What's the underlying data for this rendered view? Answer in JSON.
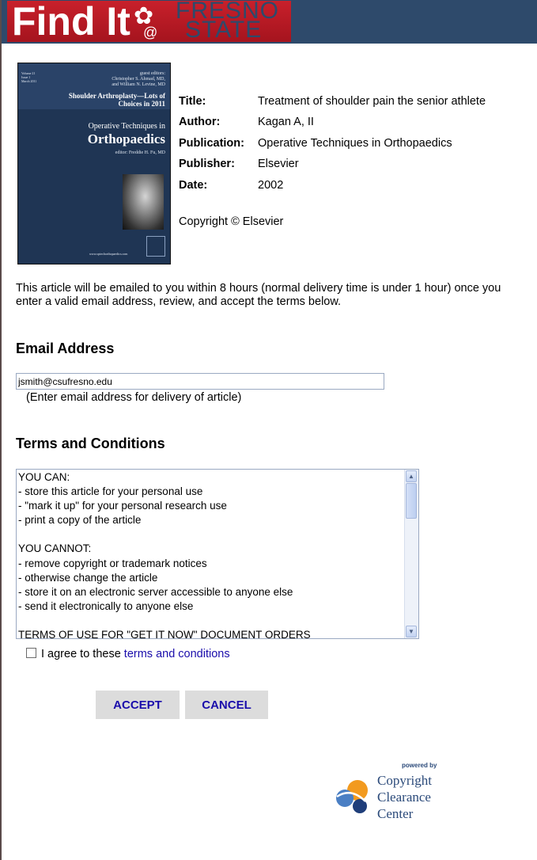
{
  "header": {
    "logo_find": "Find It",
    "logo_at": "@",
    "logo_fresno": "FRESNO",
    "logo_state": "STATE"
  },
  "cover": {
    "volume": "Volume 21\nIssue 1\nMarch 2011",
    "guest_editors": "guest editors:\nChristopher S. Ahmad, MD,\nand William N. Levine, MD",
    "headline": "Shoulder Arthroplasty—Lots of\nChoices in 2011",
    "journal_small": "Operative Techniques in",
    "journal_big": "Orthopaedics",
    "editor": "editor: Freddie H. Fu, MD",
    "url": "www.optechorthopaedics.com"
  },
  "article": {
    "title_label": "Title:",
    "title": "Treatment of shoulder pain the senior athlete",
    "author_label": "Author:",
    "author": "Kagan A, II",
    "publication_label": "Publication:",
    "publication": "Operative Techniques in Orthopaedics",
    "publisher_label": "Publisher:",
    "publisher": "Elsevier",
    "date_label": "Date:",
    "date": "2002",
    "copyright": "Copyright © Elsevier"
  },
  "notice": "This article will be emailed to you within 8 hours (normal delivery time is under 1 hour) once you enter a valid email address, review, and accept the terms below.",
  "email": {
    "heading": "Email Address",
    "value": "jsmith@csufresno.edu",
    "hint": "(Enter email address for delivery of article)"
  },
  "terms": {
    "heading": "Terms and Conditions",
    "text": "YOU CAN:\n- store this article for your personal use\n- \"mark it up\" for your personal research use\n- print a copy of the article\n\nYOU CANNOT:\n- remove copyright or trademark notices\n- otherwise change the article\n- store it on an electronic server accessible to anyone else\n- send it electronically to anyone else\n\nTERMS OF USE FOR \"GET IT NOW\" DOCUMENT ORDERS",
    "agree_prefix": "I agree to these",
    "agree_link": "terms and conditions",
    "agree_checked": false
  },
  "buttons": {
    "accept": "ACCEPT",
    "cancel": "CANCEL"
  },
  "footer": {
    "powered_by": "powered by",
    "ccc_line1": "Copyright",
    "ccc_line2": "Clearance",
    "ccc_line3": "Center"
  }
}
